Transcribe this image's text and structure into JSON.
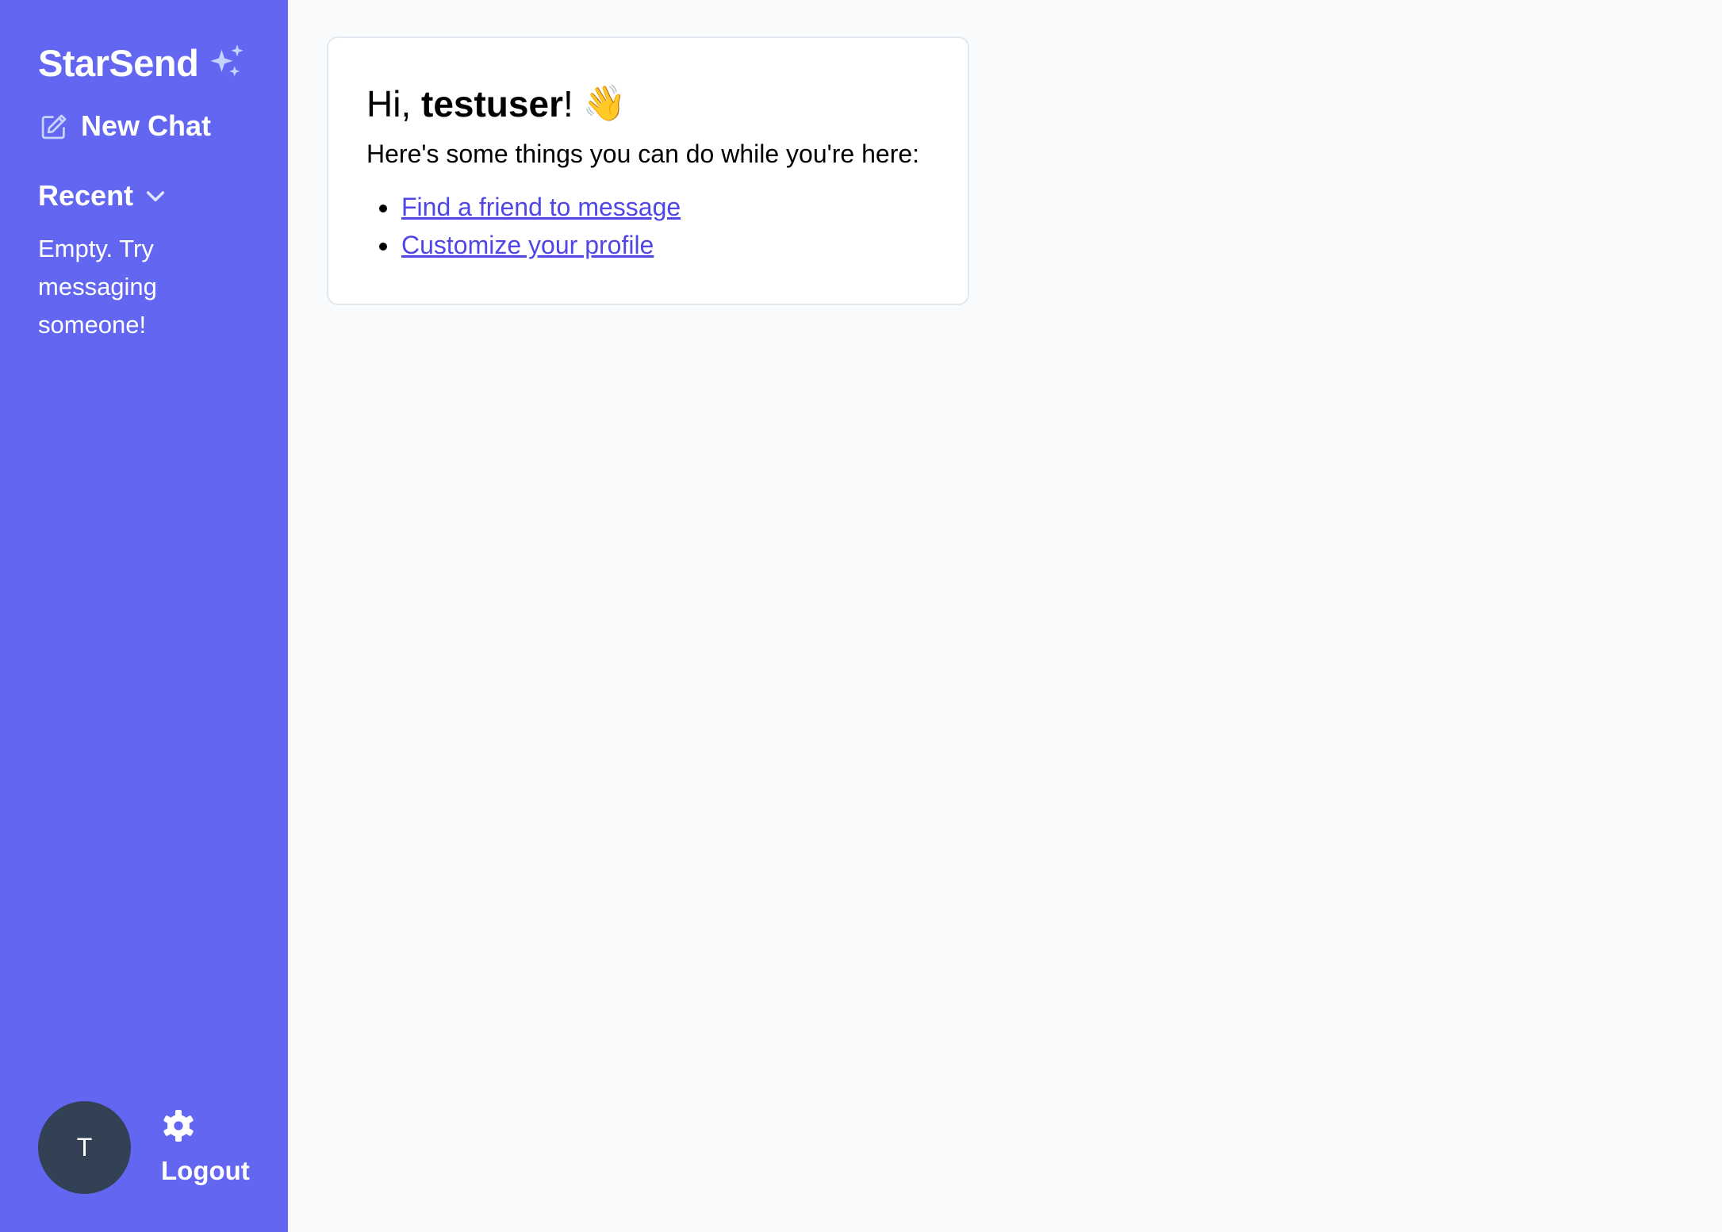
{
  "sidebar": {
    "brand": "StarSend",
    "brand_icon": "sparkles-icon",
    "new_chat_label": "New Chat",
    "new_chat_icon": "pencil-square-icon",
    "recent_label": "Recent",
    "recent_icon": "chevron-down-icon",
    "recent_empty_text": "Empty. Try messaging someone!",
    "avatar_initial": "T",
    "settings_icon": "gear-icon",
    "logout_label": "Logout"
  },
  "main": {
    "greeting_prefix": "Hi, ",
    "username": "testuser",
    "greeting_suffix": "!",
    "wave": "👋",
    "subtitle": "Here's some things you can do while you're here:",
    "actions": [
      {
        "label": "Find a friend to message"
      },
      {
        "label": "Customize your profile"
      }
    ]
  },
  "colors": {
    "sidebar_bg": "#6366f1",
    "main_bg": "#f8fafc",
    "link": "#4f46e5",
    "avatar_bg": "#334155",
    "sparkle": "#c7d2fe"
  }
}
